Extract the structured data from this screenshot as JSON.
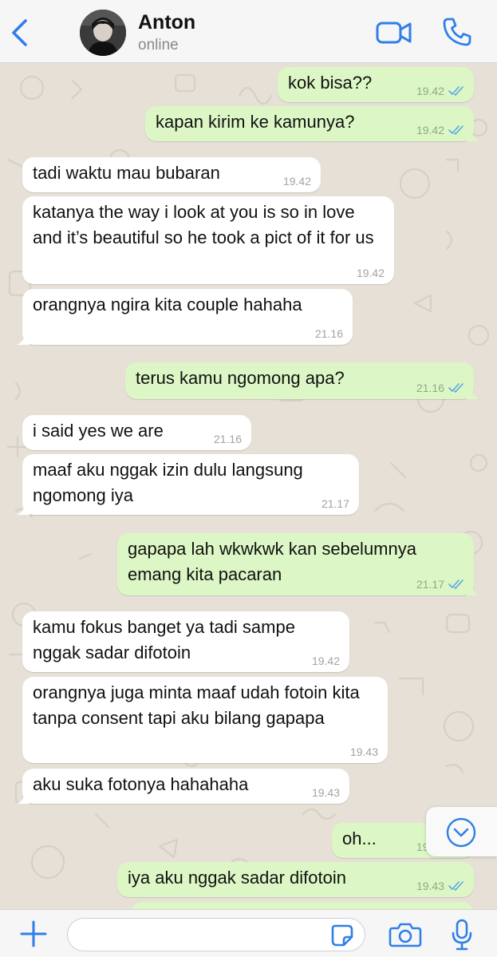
{
  "header": {
    "contact_name": "Anton",
    "contact_status": "online"
  },
  "messages": [
    {
      "dir": "out",
      "text": "kok bisa??",
      "time": "19.42",
      "read": true
    },
    {
      "dir": "out",
      "text": "kapan kirim ke kamunya?",
      "time": "19.42",
      "read": true
    },
    {
      "dir": "in",
      "text": "tadi waktu mau bubaran",
      "time": "19.42"
    },
    {
      "dir": "in",
      "text": "katanya the way i look at you is so in love and it’s beautiful so he took a pict of it for us",
      "time": "19.42"
    },
    {
      "dir": "in",
      "text": "orangnya ngira kita couple hahaha",
      "time": "21.16"
    },
    {
      "dir": "out",
      "text": "terus kamu ngomong apa?",
      "time": "21.16",
      "read": true
    },
    {
      "dir": "in",
      "text": "i said yes we are",
      "time": "21.16"
    },
    {
      "dir": "in",
      "text": "maaf aku nggak izin dulu langsung ngomong iya",
      "time": "21.17"
    },
    {
      "dir": "out",
      "text": "gapapa lah wkwkwk kan sebelumnya emang kita pacaran",
      "time": "21.17",
      "read": true
    },
    {
      "dir": "in",
      "text": "kamu fokus banget ya tadi sampe nggak sadar difotoin",
      "time": "19.42"
    },
    {
      "dir": "in",
      "text": "orangnya juga minta maaf udah fotoin kita tanpa consent tapi aku bilang gapapa",
      "time": "19.43"
    },
    {
      "dir": "in",
      "text": "aku suka fotonya hahahaha",
      "time": "19.43"
    },
    {
      "dir": "out",
      "text": "oh...",
      "time": "19.43",
      "read": true
    },
    {
      "dir": "out",
      "text": "iya aku nggak sadar difotoin",
      "time": "19.43",
      "read": true
    }
  ],
  "composer": {
    "placeholder": ""
  },
  "colors": {
    "accent": "#2f7fe8",
    "bubble_out": "#dcf7c5",
    "bubble_in": "#ffffff",
    "read_ticks": "#5aa7e6",
    "chat_bg": "#e6e0d6"
  },
  "icons": {
    "back": "chevron-left-icon",
    "video": "video-camera-icon",
    "call": "phone-icon",
    "scroll_down": "chevron-down-circle-icon",
    "plus": "plus-icon",
    "sticker": "sticker-icon",
    "camera": "camera-icon",
    "mic": "microphone-icon"
  }
}
